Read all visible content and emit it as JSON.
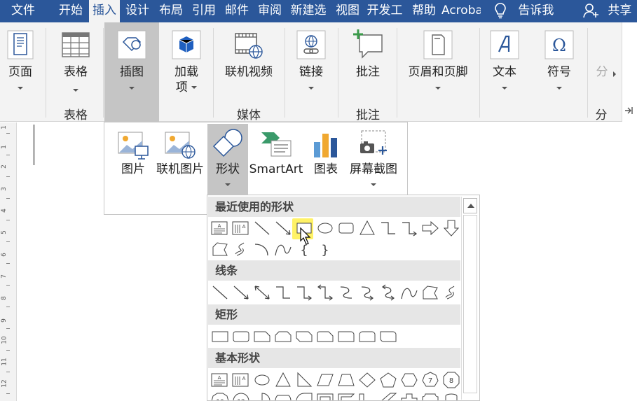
{
  "tabs": [
    "文件",
    "开始",
    "插入",
    "设计",
    "布局",
    "引用",
    "邮件",
    "审阅",
    "新建选",
    "视图",
    "开发工",
    "帮助",
    "Acrobat"
  ],
  "active_tab": "插入",
  "tell_me": "告诉我",
  "share": "共享",
  "ribbon": {
    "pages": "页面",
    "table": "表格",
    "illustrations": "插图",
    "addins_line1": "加载",
    "addins_line2": "项",
    "online_video": "联机视频",
    "link": "链接",
    "comment": "批注",
    "header_footer": "页眉和页脚",
    "text": "文本",
    "symbol": "符号",
    "partial": "分",
    "group_table": "表格",
    "group_media": "媒体",
    "group_comment": "批注",
    "group_partial": "分"
  },
  "ruler_numbers": [
    "1",
    "1",
    "2",
    "3",
    "4",
    "5",
    "6",
    "7",
    "8",
    "9",
    "10",
    "11",
    "12"
  ],
  "dropdown": {
    "picture": "图片",
    "online_picture": "联机图片",
    "shapes": "形状",
    "smartart": "SmartArt",
    "chart": "图表",
    "screenshot": "屏幕截图"
  },
  "gallery": {
    "recent": "最近使用的形状",
    "lines": "线条",
    "rectangles": "矩形",
    "basic": "基本形状"
  },
  "colors": {
    "accent": "#2b579a",
    "ribbon_bg": "#f3f3f3",
    "highlight": "#ffee33"
  }
}
